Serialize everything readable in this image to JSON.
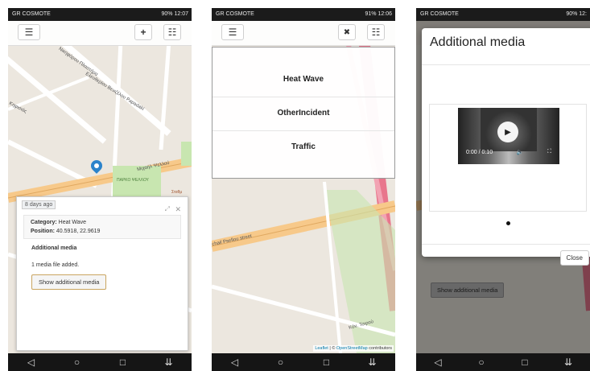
{
  "colors": {
    "primary": "#2b83cb",
    "road_major": "#f7c98a",
    "road_red": "#e8768c",
    "park": "#c8e6b0",
    "accent_border": "#c9a560"
  },
  "status_bar": [
    {
      "carrier": "GR COSMOTE",
      "right": "90% 12:07"
    },
    {
      "carrier": "GR COSMOTE",
      "right": "91% 12:06"
    },
    {
      "carrier": "GR COSMOTE",
      "right": "90% 12:"
    }
  ],
  "nav_icons": [
    "back-icon",
    "home-icon",
    "recents-icon",
    "notification-icon"
  ],
  "screen1": {
    "toolbar": {
      "menu_icon": "hamburger-icon",
      "add_label": "+",
      "list_icon": "list-icon"
    },
    "map_labels": [
      "Νικηφόρου Πλαστήρα",
      "Ελευθερίου Βενιζέλου Papadaki",
      "Κηφισιάς",
      "Μιχαήλ Ψελλού",
      "ΠΑΡΚΟ ΨΕΛΛΟΥ",
      "Σταθμ"
    ],
    "popup": {
      "time": "8 days ago",
      "category_label": "Category:",
      "category_value": "Heat Wave",
      "position_label": "Position:",
      "position_value": "40.5918, 22.9619",
      "media_heading": "Additional media",
      "media_text": "1 media file added.",
      "show_button": "Show additional media"
    }
  },
  "screen2": {
    "toolbar": {
      "menu_icon": "hamburger-icon",
      "close_label": "✖",
      "list_icon": "list-icon"
    },
    "menu_items": [
      "Heat Wave",
      "OtherIncident",
      "Traffic"
    ],
    "map_labels": [
      "chail Psellou street",
      "Κόν. Τσιρού"
    ],
    "attribution": {
      "leaflet": "Leaflet",
      "sep": " | © ",
      "osm": "OpenStreetMap",
      "contributors": " contributors"
    }
  },
  "screen3": {
    "modal": {
      "title": "Additional media",
      "close_x": "×",
      "video_time": "0:00 / 0:10",
      "close_button": "Close"
    },
    "behind_button": "Show additional media"
  }
}
